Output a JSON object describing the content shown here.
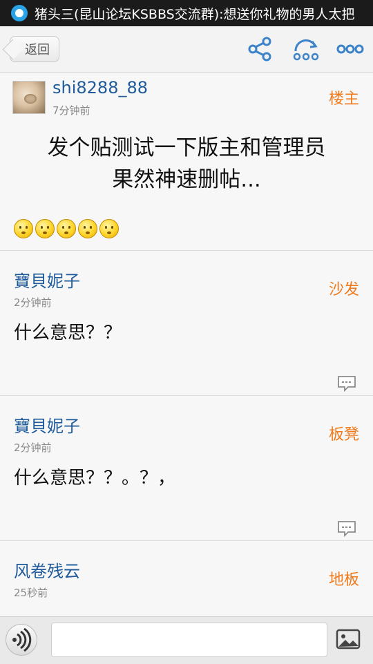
{
  "status_bar": {
    "notification_text": "猪头三(昆山论坛KSBBS交流群):想送你礼物的男人太把"
  },
  "nav": {
    "back_label": "返回",
    "icons": [
      "share-icon",
      "refresh-icon",
      "more-icon"
    ]
  },
  "original_post": {
    "username": "shi8288_88",
    "time": "7分钟前",
    "floor": "楼主",
    "title_line1": "发个贴测试一下版主和管理员",
    "title_line2": "果然神速删帖...",
    "emoji_count": 5
  },
  "replies": [
    {
      "username": "寶貝妮子",
      "time": "2分钟前",
      "floor": "沙发",
      "content": "什么意思？？"
    },
    {
      "username": "寶貝妮子",
      "time": "2分钟前",
      "floor": "板凳",
      "content": "什么意思？？。？，"
    },
    {
      "username": "风卷残云",
      "time": "25秒前",
      "floor": "地板",
      "content": ""
    }
  ],
  "bottom_bar": {
    "input_placeholder": "",
    "icons": [
      "voice-icon",
      "image-icon"
    ]
  },
  "colors": {
    "username": "#1f5b9a",
    "floor": "#f07a1c",
    "status_bar": "#1b1b1b"
  }
}
